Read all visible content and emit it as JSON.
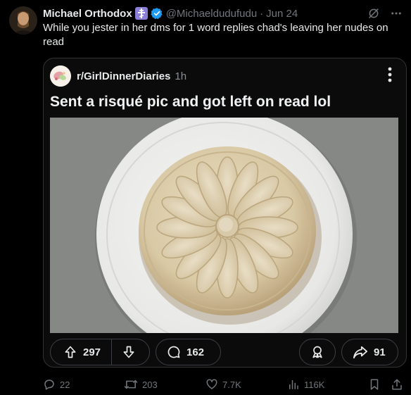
{
  "tweet": {
    "author_name": "Michael Orthodox",
    "handle": "@Michaeldudufudu",
    "separator": "·",
    "date": "Jun 24",
    "text": "While you jester in her dms for 1 word replies chad's leaving her nudes on read"
  },
  "embed": {
    "subreddit": "r/GirlDinnerDiaries",
    "age": "1h",
    "title": "Sent a risqué pic and got left on read lol",
    "upvotes": "297",
    "comments": "162",
    "shares": "91"
  },
  "stats": {
    "replies": "22",
    "reposts": "203",
    "likes": "7.7K",
    "views": "116K"
  },
  "colors": {
    "background": "#000000",
    "muted": "#71767b",
    "verified": "#1d9bf0",
    "badge_purple": "#8b7fd8"
  },
  "icons": [
    "orthodox-cross-badge-icon",
    "verified-icon",
    "grok-icon",
    "more-icon",
    "kebab-icon",
    "upvote-icon",
    "downvote-icon",
    "comment-icon",
    "award-icon",
    "share-icon",
    "reply-icon",
    "repost-icon",
    "like-icon",
    "views-icon",
    "bookmark-icon",
    "upload-icon"
  ]
}
